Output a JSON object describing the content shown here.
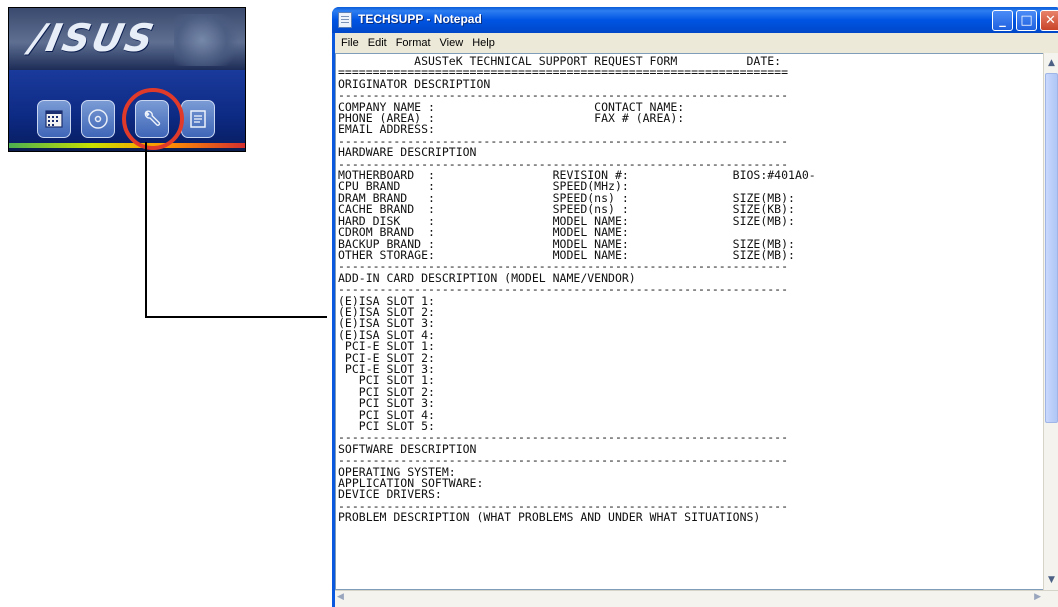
{
  "launcher": {
    "logo_text": "/ISUS",
    "buttons": [
      {
        "name": "system-info",
        "icon": "calendar-grid-icon"
      },
      {
        "name": "drivers-cd",
        "icon": "cd-disc-icon"
      },
      {
        "name": "tech-support",
        "icon": "wrench-icon",
        "highlighted": true
      },
      {
        "name": "readme",
        "icon": "document-icon"
      }
    ],
    "highlight_color": "#e03a2a"
  },
  "window": {
    "title": "TECHSUPP - Notepad",
    "controls": {
      "minimize": "_",
      "maximize": "□",
      "close": "✕"
    },
    "title_bar_color": "#0054e3"
  },
  "menu": {
    "file": "File",
    "edit": "Edit",
    "format": "Format",
    "view": "View",
    "help": "Help"
  },
  "document": {
    "lines": [
      "           ASUSTeK TECHNICAL SUPPORT REQUEST FORM          DATE:",
      "=================================================================",
      "ORIGINATOR DESCRIPTION",
      "-----------------------------------------------------------------",
      "COMPANY NAME :                       CONTACT NAME:",
      "PHONE (AREA) :                       FAX # (AREA):",
      "EMAIL ADDRESS:",
      "-----------------------------------------------------------------",
      "HARDWARE DESCRIPTION",
      "-----------------------------------------------------------------",
      "MOTHERBOARD  :                 REVISION #:               BIOS:#401A0-",
      "CPU BRAND    :                 SPEED(MHz):",
      "DRAM BRAND   :                 SPEED(ns) :               SIZE(MB):",
      "CACHE BRAND  :                 SPEED(ns) :               SIZE(KB):",
      "HARD DISK    :                 MODEL NAME:               SIZE(MB):",
      "CDROM BRAND  :                 MODEL NAME:",
      "BACKUP BRAND :                 MODEL NAME:               SIZE(MB):",
      "OTHER STORAGE:                 MODEL NAME:               SIZE(MB):",
      "-----------------------------------------------------------------",
      "ADD-IN CARD DESCRIPTION (MODEL NAME/VENDOR)",
      "-----------------------------------------------------------------",
      "(E)ISA SLOT 1:",
      "(E)ISA SLOT 2:",
      "(E)ISA SLOT 3:",
      "(E)ISA SLOT 4:",
      " PCI-E SLOT 1:",
      " PCI-E SLOT 2:",
      " PCI-E SLOT 3:",
      "   PCI SLOT 1:",
      "   PCI SLOT 2:",
      "   PCI SLOT 3:",
      "   PCI SLOT 4:",
      "   PCI SLOT 5:",
      "-----------------------------------------------------------------",
      "SOFTWARE DESCRIPTION",
      "-----------------------------------------------------------------",
      "OPERATING SYSTEM:",
      "APPLICATION SOFTWARE:",
      "DEVICE DRIVERS:",
      "-----------------------------------------------------------------",
      "PROBLEM DESCRIPTION (WHAT PROBLEMS AND UNDER WHAT SITUATIONS)"
    ]
  }
}
